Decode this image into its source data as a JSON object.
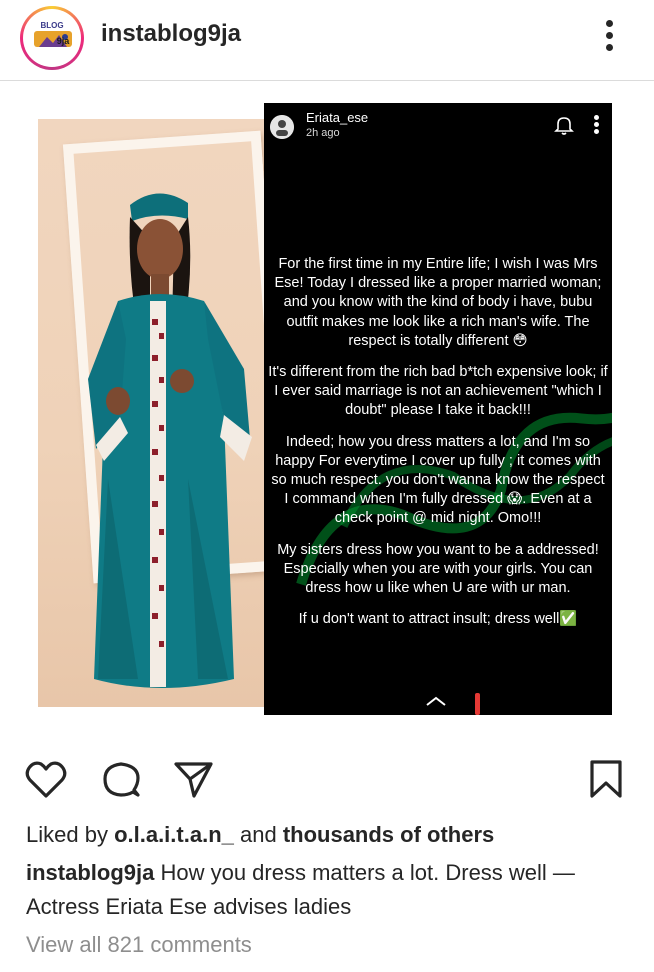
{
  "header": {
    "username": "instablog9ja",
    "avatar_logo_text": "instablog9ja"
  },
  "story": {
    "author": "Eriata_ese",
    "time": "2h ago",
    "paragraphs": [
      "For the first time in my Entire life; I wish I was Mrs Ese! Today I dressed like a proper married woman; and you know with the kind of body i have, bubu outfit makes me look like a rich man's wife. The respect is totally different 😳",
      "It's different from the rich bad b*tch expensive look; if I ever said marriage is not an achievement \"which I doubt\" please I take it back!!!",
      "Indeed; how you dress matters a lot, and I'm so happy For everytime I cover up fully ; it comes with so much respect. you don't wanna know the respect I command when I'm fully dressed 😱. Even at a check point @ mid night. Omo!!!",
      "My sisters dress how you want to be a addressed! Especially when you are with your girls. You can dress how u like when U are with ur man.",
      "If u don't want to attract insult; dress well✅"
    ]
  },
  "actions": {
    "like_icon": "heart-icon",
    "comment_icon": "comment-icon",
    "share_icon": "paper-plane-icon",
    "save_icon": "bookmark-icon"
  },
  "likes": {
    "prefix": "Liked by ",
    "user": "o.l.a.i.t.a.n_",
    "middle": " and ",
    "others": "thousands of others"
  },
  "caption": {
    "username": "instablog9ja",
    "text": " How you dress matters a lot. Dress well — Actress Eriata Ese advises ladies"
  },
  "comments": {
    "view_all": "View all 821 comments"
  },
  "colors": {
    "text": "#262626",
    "muted": "#8e8e8e",
    "divider": "#dbdbdb",
    "dress_teal": "#0f7b86",
    "watermark_green": "#009632"
  }
}
